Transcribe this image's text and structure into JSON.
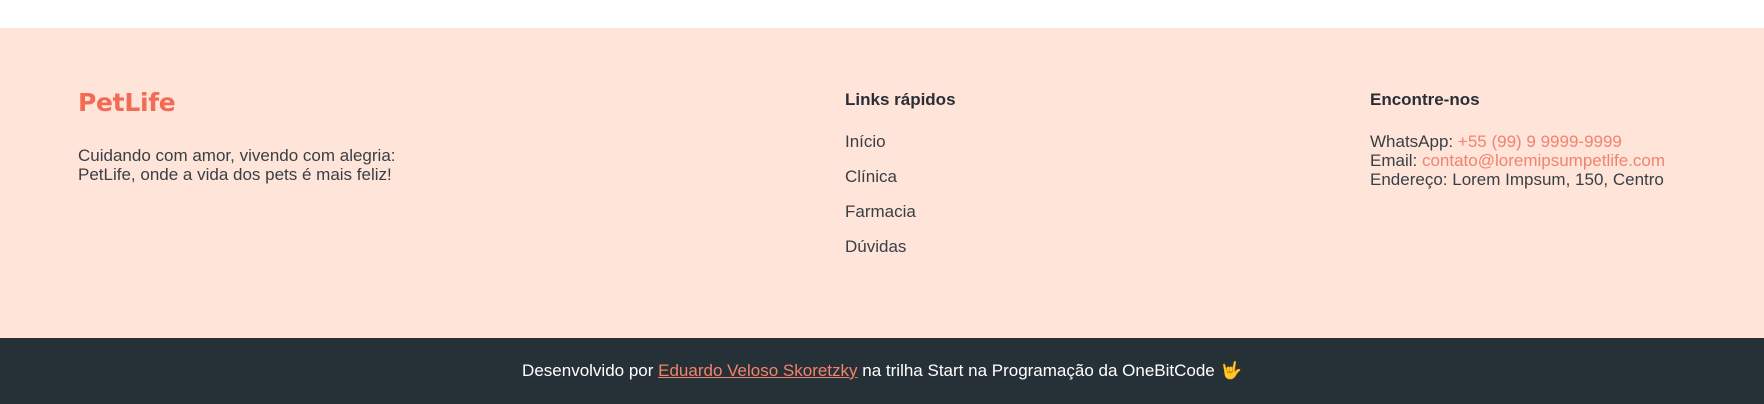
{
  "brand": {
    "name": "PetLife",
    "tagline_line1": "Cuidando com amor, vivendo com alegria:",
    "tagline_line2": "PetLife, onde a vida dos pets é mais feliz!"
  },
  "quick_links": {
    "title": "Links rápidos",
    "items": [
      {
        "label": "Início"
      },
      {
        "label": "Clínica"
      },
      {
        "label": "Farmacia"
      },
      {
        "label": "Dúvidas"
      }
    ]
  },
  "contact": {
    "title": "Encontre-nos",
    "whatsapp_label": "WhatsApp:",
    "whatsapp_value": "+55 (99) 9 9999-9999",
    "email_label": "Email:",
    "email_value": "contato@loremipsumpetlife.com",
    "address_label": "Endereço:",
    "address_value": "Lorem Impsum, 150, Centro"
  },
  "credits": {
    "prefix": "Desenvolvido por",
    "author": "Eduardo Veloso Skoretzky",
    "suffix": "na trilha Start na Programação da OneBitCode",
    "emoji": "🤟"
  },
  "colors": {
    "footer_bg": "#ffe4da",
    "bottom_bar_bg": "#263137",
    "accent": "#f26b55",
    "link_accent": "#f2836d"
  }
}
